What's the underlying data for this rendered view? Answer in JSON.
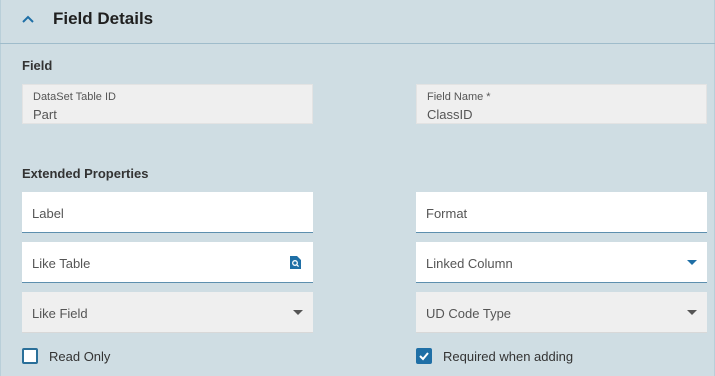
{
  "header": {
    "title": "Field Details",
    "collapse_icon": "chevron-up-icon"
  },
  "field_section": {
    "heading": "Field",
    "dataset_table_id": {
      "label": "DataSet Table ID",
      "value": "Part"
    },
    "field_name": {
      "label": "Field Name *",
      "value": "ClassID"
    }
  },
  "extended_section": {
    "heading": "Extended Properties",
    "label_input": {
      "placeholder": "Label"
    },
    "format_input": {
      "placeholder": "Format"
    },
    "like_table": {
      "placeholder": "Like Table",
      "icon": "search-icon"
    },
    "linked_column": {
      "placeholder": "Linked Column",
      "icon": "chevron-down-icon"
    },
    "like_field": {
      "placeholder": "Like Field",
      "icon": "chevron-down-icon"
    },
    "ud_code_type": {
      "placeholder": "UD Code Type",
      "icon": "chevron-down-icon"
    }
  },
  "checkboxes": {
    "read_only": {
      "label": "Read Only",
      "checked": false
    },
    "required_when_adding": {
      "label": "Required when adding",
      "checked": true
    }
  },
  "colors": {
    "accent": "#1f6fa6",
    "background": "#cfdde3",
    "readonly_bg": "#efefef"
  }
}
